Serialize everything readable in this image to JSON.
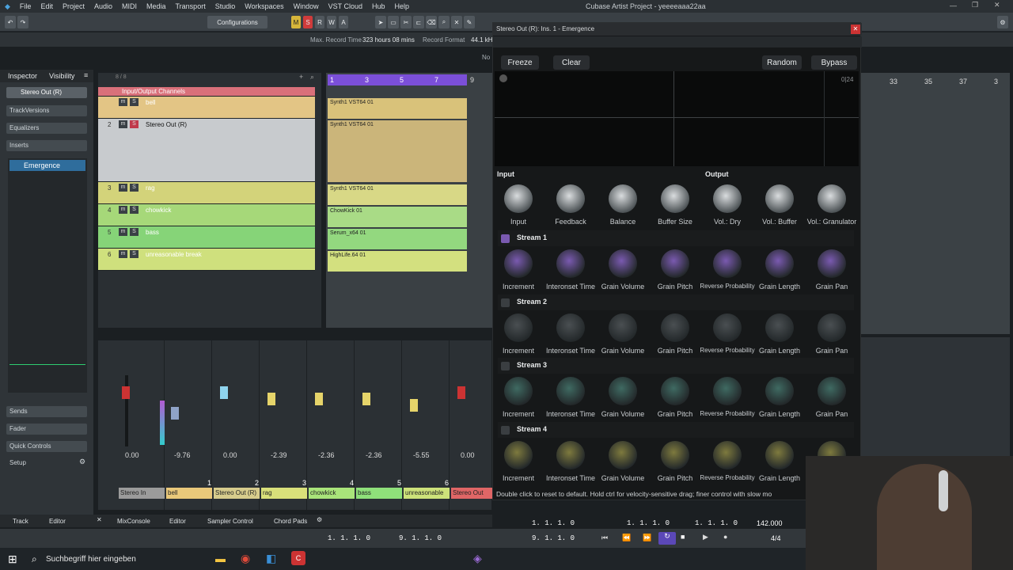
{
  "menu": {
    "items": [
      "File",
      "Edit",
      "Project",
      "Audio",
      "MIDI",
      "Media",
      "Transport",
      "Studio",
      "Workspaces",
      "Window",
      "VST Cloud",
      "Hub",
      "Help"
    ],
    "window_title": "Cubase Artist Project - yeeeeaaa22aa"
  },
  "toolbar": {
    "configurations": "Configurations",
    "m": "M",
    "s": "S",
    "r": "R",
    "w": "W",
    "a": "A"
  },
  "infoline": {
    "max_record_label": "Max. Record Time",
    "max_record_value": "323 hours 08 mins",
    "record_format_label": "Record Format",
    "record_format_value": "44.1 kH",
    "no_label": "No"
  },
  "inspector": {
    "tabs": [
      "Inspector",
      "Visibility"
    ],
    "track_name": "Stereo Out (R)",
    "rows": [
      "TrackVersions",
      "Equalizers",
      "Inserts"
    ],
    "insert_slot": "Emergence",
    "bottom_rows": [
      "Sends",
      "Fader",
      "Quick Controls"
    ],
    "setup": "Setup"
  },
  "tracklist": {
    "header": "Input/Output Channels",
    "counter": "8 / 8",
    "tracks": [
      {
        "num": "1",
        "name": "bell"
      },
      {
        "num": "2",
        "name": "Stereo Out (R)"
      },
      {
        "num": "3",
        "name": "rag"
      },
      {
        "num": "4",
        "name": "chowkick"
      },
      {
        "num": "5",
        "name": "bass"
      },
      {
        "num": "6",
        "name": "unreasonable break"
      }
    ]
  },
  "ruler": {
    "marks": [
      "1",
      "3",
      "5",
      "7",
      "9"
    ],
    "right_marks": [
      "33",
      "35",
      "37",
      "3"
    ]
  },
  "parts": [
    "Synth1 VST64 01",
    "Synth1 VST64 01",
    "Synth1 VST64 01",
    "ChowKick 01",
    "Serum_x64 01",
    "HighLife.64 01"
  ],
  "mixer": {
    "channels": [
      {
        "name": "Stereo In",
        "value": "0.00",
        "num": "",
        "color": "#9b9b9b"
      },
      {
        "name": "bell",
        "value": "-9.76",
        "num": "1",
        "color": "#e9c87a"
      },
      {
        "name": "Stereo Out (R)",
        "value": "0.00",
        "num": "2",
        "color": "#d7cc8c"
      },
      {
        "name": "rag",
        "value": "-2.39",
        "num": "3",
        "color": "#d9e07a"
      },
      {
        "name": "chowkick",
        "value": "-2.36",
        "num": "4",
        "color": "#a9e47a"
      },
      {
        "name": "bass",
        "value": "-2.36",
        "num": "5",
        "color": "#8fe07a"
      },
      {
        "name": "unreasonable",
        "value": "-5.55",
        "num": "6",
        "color": "#cde27a"
      },
      {
        "name": "Stereo Out",
        "value": "0.00",
        "num": "",
        "color": "#e06666"
      }
    ]
  },
  "bottom_tabs": [
    "Track",
    "Editor",
    "MixConsole",
    "Editor",
    "Sampler Control",
    "Chord Pads"
  ],
  "transport": {
    "left_pos": "1. 1. 1.   0",
    "left_pos2": "9. 1. 1.   0",
    "pos1": "1. 1. 1.   0",
    "pos2": "9. 1. 1.   0",
    "pos3": "1. 1. 1.   0",
    "pos4": "1. 1. 1.   0",
    "tempo": "142.000",
    "signature": "4/4"
  },
  "taskbar": {
    "search_placeholder": "Suchbegriff hier eingeben"
  },
  "plugin": {
    "title": "Stereo Out (R): Ins. 1 - Emergence",
    "buttons": {
      "freeze": "Freeze",
      "clear": "Clear",
      "random": "Random",
      "bypass": "Bypass"
    },
    "scope_label": "0|24",
    "input_label": "Input",
    "output_label": "Output",
    "io_knobs": [
      "Input",
      "Feedback",
      "Balance",
      "Buffer Size",
      "Vol.: Dry",
      "Vol.: Buffer",
      "Vol.: Granulator"
    ],
    "stream_knobs": [
      "Increment",
      "Interonset Time",
      "Grain Volume",
      "Grain Pitch",
      "Reverse Probability",
      "Grain Length",
      "Grain Pan"
    ],
    "streams": [
      {
        "title": "Stream 1",
        "color": "#7a5ab0"
      },
      {
        "title": "Stream 2",
        "color": "#4a4f52"
      },
      {
        "title": "Stream 3",
        "color": "#3f6a62"
      },
      {
        "title": "Stream 4",
        "color": "#7e7a3e"
      }
    ],
    "status": "Double click to reset to default. Hold ctrl for velocity-sensitive drag; finer control with slow mo"
  }
}
